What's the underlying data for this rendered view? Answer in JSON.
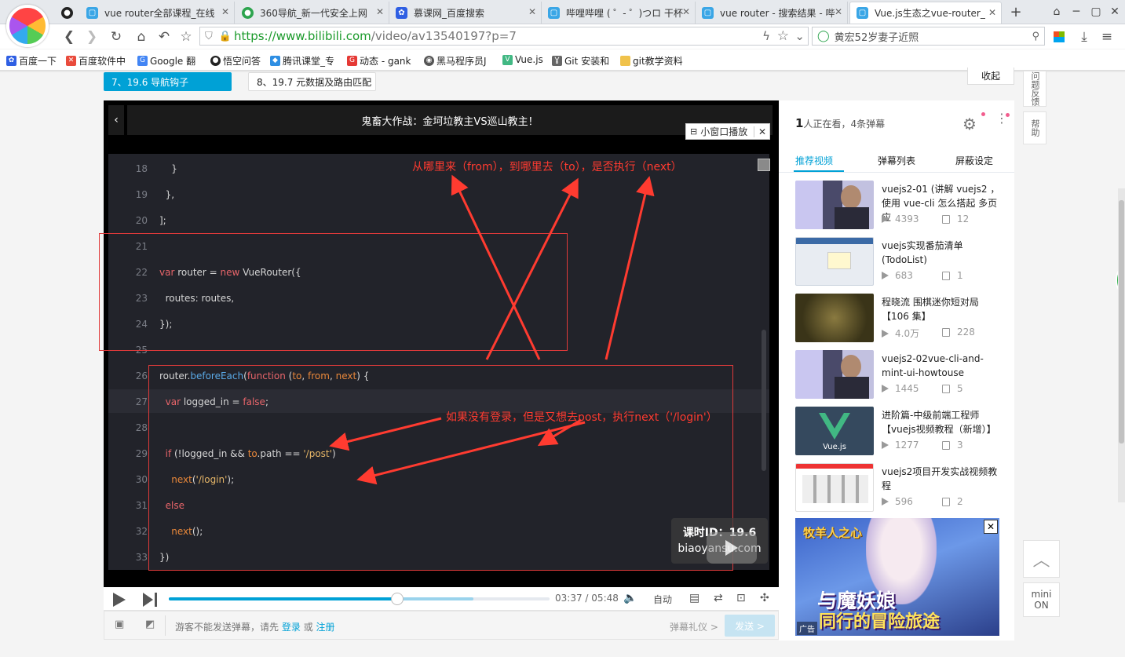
{
  "browser": {
    "tabs": [
      {
        "label": "vue router全部课程_在线",
        "icon": "bili-tv-icon"
      },
      {
        "label": "360导航_新一代安全上网",
        "icon": "360-icon"
      },
      {
        "label": "慕课网_百度搜索",
        "icon": "baidu-paw-icon"
      },
      {
        "label": "哔哩哔哩 ( ゜- ゜)つロ 干杯",
        "icon": "bili-tv-icon"
      },
      {
        "label": "vue router - 搜索结果 - 哔",
        "icon": "bili-tv-icon"
      },
      {
        "label": "Vue.js生态之vue-router_",
        "icon": "bili-tv-icon"
      }
    ],
    "active_tab": 5,
    "url_prefix": "https://www.bilibili.com",
    "url_rest": "/video/av13540197?p=7",
    "search_text": "黄宏52岁妻子近照",
    "bookmarks": [
      "百度一下",
      "百度软件中",
      "Google 翻",
      "悟空问答",
      "腾讯课堂_专",
      "动态 - gank",
      "黑马程序员J",
      "Vue.js",
      "Git 安装和",
      "git教学资料"
    ]
  },
  "episodes": [
    {
      "label": "7、19.6 导航钩子",
      "active": true
    },
    {
      "label": "8、19.7 元数据及路由匹配",
      "active": false
    }
  ],
  "collapse_label": "收起",
  "video": {
    "danmaku_title": "鬼畜大作战：金坷垃教主VS巡山教主！",
    "mini_window_label": "小窗口播放",
    "watermark_line1": "课时ID：19.6",
    "watermark_line2": "biaoyansu.com",
    "annotation_top": "从哪里来（from），到哪里去（to），是否执行（next）",
    "annotation_mid": "如果没有登录，但是又想去post，执行next（'/login'）",
    "current_time": "03:37",
    "sep": "/",
    "total_time": "05:48",
    "progress": 0.6,
    "buffered": 0.8,
    "auto_label": "自动"
  },
  "danmaku_bar": {
    "notice": "游客不能发送弹幕，请先",
    "login": "登录",
    "or": "或",
    "register": "注册",
    "etiquette": "弹幕礼仪 >",
    "send": "发送 >"
  },
  "sidebar": {
    "viewers_count": "1",
    "viewers_text": "人正在看，4条弹幕",
    "tabs": [
      "推荐视频",
      "弹幕列表",
      "屏蔽设定"
    ],
    "items": [
      {
        "title": "vuejs2-01 (讲解 vuejs2 ，使用 vue-cli 怎么搭起 多页应",
        "plays": "4393",
        "danmaku": "12"
      },
      {
        "title": "vuejs实现番茄清单(TodoList)",
        "plays": "683",
        "danmaku": "1"
      },
      {
        "title": "程晓流 围棋迷你短对局【106 集】",
        "plays": "4.0万",
        "danmaku": "228"
      },
      {
        "title": "vuejs2-02vue-cli-and-mint-ui-howtouse",
        "plays": "1445",
        "danmaku": "5"
      },
      {
        "title": "进阶篇-中级前端工程师【vuejs视频教程（新增）】",
        "plays": "1277",
        "danmaku": "3"
      },
      {
        "title": "vuejs2项目开发实战视频教程",
        "plays": "596",
        "danmaku": "2"
      }
    ],
    "ad_title_line1": "与魔妖娘",
    "ad_title_line2": "同行的冒险旅途",
    "ad_game": "牧羊人之心",
    "ad_label": "广告",
    "vuejs_thumb_label": "Vue.js"
  },
  "right_bar": {
    "feedback": "问题反馈",
    "help": "帮助",
    "mini": "mini",
    "on": "ON"
  },
  "code_lines": [
    {
      "no": "18",
      "parts": [
        [
          "pu",
          "    }"
        ]
      ]
    },
    {
      "no": "19",
      "parts": [
        [
          "pu",
          "  },"
        ]
      ]
    },
    {
      "no": "20",
      "parts": [
        [
          "pu",
          "];"
        ]
      ]
    },
    {
      "no": "21",
      "parts": []
    },
    {
      "no": "22",
      "parts": [
        [
          "kw",
          "var"
        ],
        [
          "pu",
          " router = "
        ],
        [
          "kw",
          "new"
        ],
        [
          "pu",
          " VueRouter({"
        ]
      ]
    },
    {
      "no": "23",
      "parts": [
        [
          "pu",
          "  routes: routes,"
        ]
      ]
    },
    {
      "no": "24",
      "parts": [
        [
          "pu",
          "});"
        ]
      ]
    },
    {
      "no": "25",
      "parts": []
    },
    {
      "no": "26",
      "parts": [
        [
          "pu",
          "router."
        ],
        [
          "fn",
          "beforeEach"
        ],
        [
          "pu",
          "("
        ],
        [
          "kw",
          "function"
        ],
        [
          "pu",
          " ("
        ],
        [
          "pm",
          "to"
        ],
        [
          "pu",
          ", "
        ],
        [
          "pm",
          "from"
        ],
        [
          "pu",
          ", "
        ],
        [
          "pm",
          "next"
        ],
        [
          "pu",
          ") {"
        ]
      ]
    },
    {
      "no": "27",
      "parts": [
        [
          "kw",
          "  var"
        ],
        [
          "pu",
          " logged_in = "
        ],
        [
          "kw",
          "false"
        ],
        [
          "pu",
          ";"
        ]
      ]
    },
    {
      "no": "28",
      "parts": []
    },
    {
      "no": "29",
      "parts": [
        [
          "kw",
          "  if"
        ],
        [
          "pu",
          " (!logged_in && "
        ],
        [
          "pm",
          "to"
        ],
        [
          "pu",
          ".path == "
        ],
        [
          "st",
          "'/post'"
        ],
        [
          "pu",
          ")"
        ]
      ]
    },
    {
      "no": "30",
      "parts": [
        [
          "pu",
          "    "
        ],
        [
          "pm",
          "next"
        ],
        [
          "pu",
          "("
        ],
        [
          "st",
          "'/login'"
        ],
        [
          "pu",
          ");"
        ]
      ]
    },
    {
      "no": "31",
      "parts": [
        [
          "kw",
          "  else"
        ]
      ]
    },
    {
      "no": "32",
      "parts": [
        [
          "pu",
          "    "
        ],
        [
          "pm",
          "next"
        ],
        [
          "pu",
          "();"
        ]
      ]
    },
    {
      "no": "33",
      "parts": [
        [
          "pu",
          "})"
        ]
      ]
    }
  ],
  "colors": {
    "accent": "#00a1d6",
    "annotation": "#ff3b30"
  }
}
